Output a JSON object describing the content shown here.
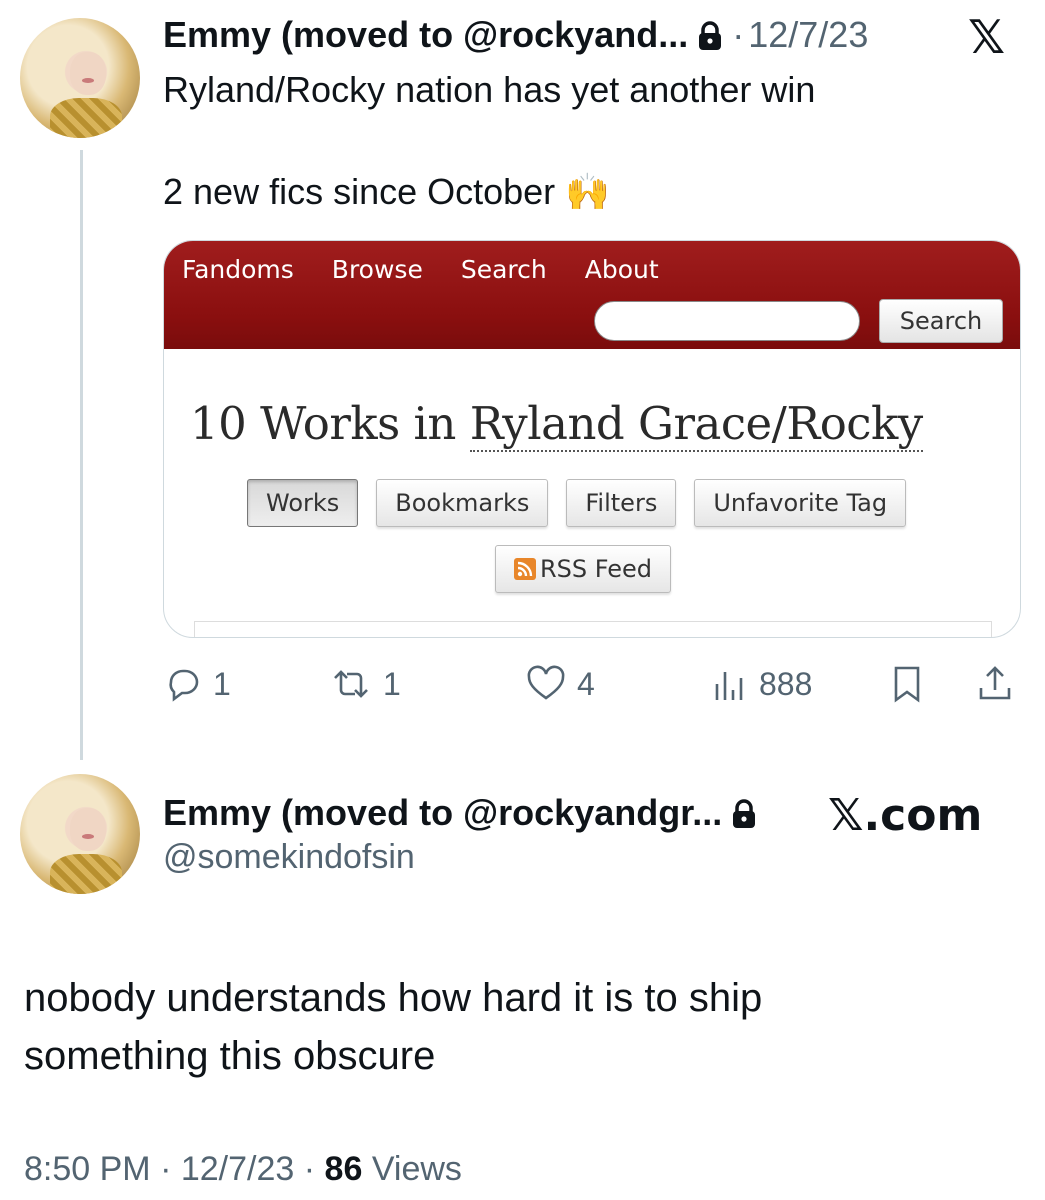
{
  "quoted_tweet": {
    "author_name": "Emmy (moved to @rockyand...",
    "separator": "·",
    "date": "12/7/23",
    "text_line1": "Ryland/Rocky nation has yet another win",
    "text_line2": "2 new fics since October 🙌",
    "platform_logo": "𝕏",
    "embedded_image": {
      "nav": [
        "Fandoms",
        "Browse",
        "Search",
        "About"
      ],
      "search_button": "Search",
      "title_prefix": "10 Works in ",
      "title_tag": "Ryland Grace/Rocky",
      "buttons": [
        "Works",
        "Bookmarks",
        "Filters",
        "Unfavorite Tag"
      ],
      "rss_label": "RSS Feed"
    },
    "actions": {
      "replies": "1",
      "reposts": "1",
      "likes": "4",
      "views": "888"
    }
  },
  "main_tweet": {
    "author_name": "Emmy (moved to @rockyandgr...",
    "handle": "@somekindofsin",
    "platform_logo": "𝕏.com",
    "text_line1": "nobody understands how hard it is to ship",
    "text_line2": "something this obscure",
    "time": "8:50 PM",
    "separator": "·",
    "date": "12/7/23",
    "separator2": "·",
    "views_count": "86",
    "views_label": "Views"
  },
  "colors": {
    "text_primary": "#0f1419",
    "text_secondary": "#536471",
    "ao3_red": "#8a0f0f"
  }
}
